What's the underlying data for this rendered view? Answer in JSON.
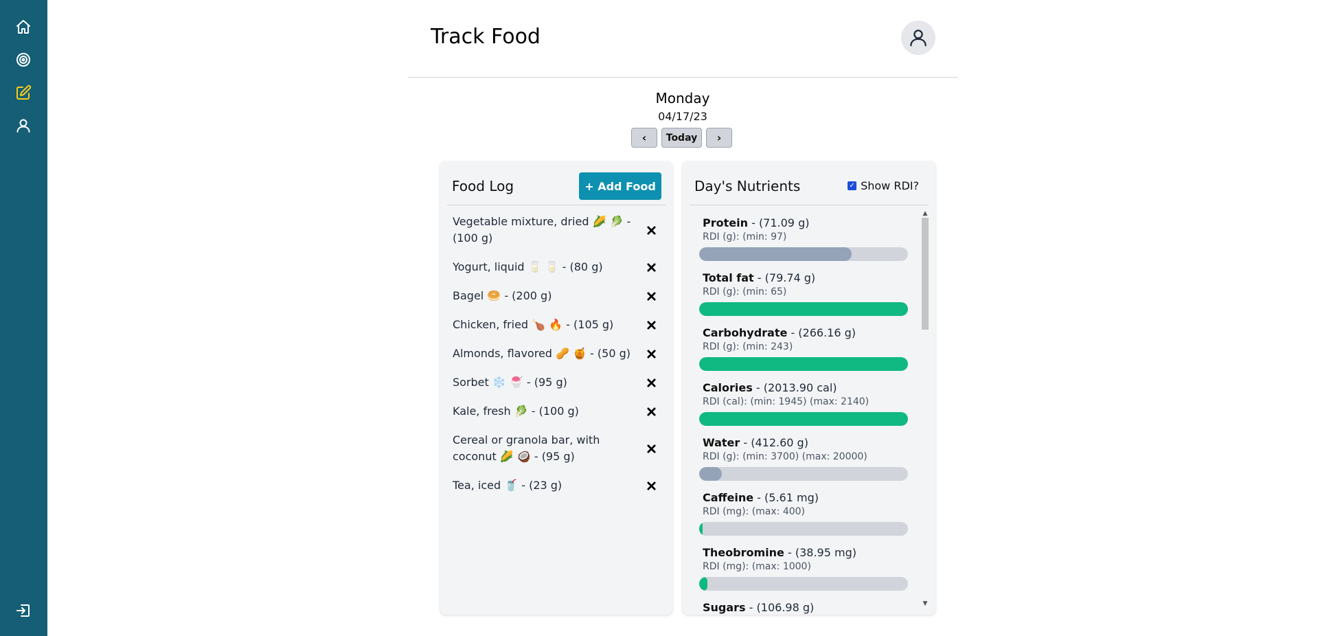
{
  "nav": {
    "items": [
      {
        "name": "home",
        "icon": "home-icon"
      },
      {
        "name": "goals",
        "icon": "target-icon"
      },
      {
        "name": "track",
        "icon": "edit-icon",
        "active": true
      },
      {
        "name": "profile",
        "icon": "user-icon"
      }
    ],
    "logout_icon": "logout-icon"
  },
  "header": {
    "title": "Track Food",
    "avatar_icon": "user-icon"
  },
  "date": {
    "day": "Monday",
    "date": "04/17/23",
    "prev_label": "‹",
    "today_label": "Today",
    "next_label": "›"
  },
  "food_log": {
    "title": "Food Log",
    "add_label": "+ Add Food",
    "items": [
      "Vegetable mixture, dried 🌽 🥬 - (100 g)",
      "Yogurt, liquid 🥛 🥛 - (80 g)",
      "Bagel 🥯 - (200 g)",
      "Chicken, fried 🍗 🔥 - (105 g)",
      "Almonds, flavored 🥜 🍯 - (50 g)",
      "Sorbet ❄️ 🍧 - (95 g)",
      "Kale, fresh 🥬 - (100 g)",
      "Cereal or granola bar, with coconut 🌽 🥥 - (95 g)",
      "Tea, iced 🥤 - (23 g)"
    ]
  },
  "nutrients": {
    "title": "Day's Nutrients",
    "rdi_label": "Show RDI?",
    "rdi_checked": true,
    "colors": {
      "good": "#10b981",
      "low": "#94a3b8",
      "track": "#d1d5db"
    },
    "items": [
      {
        "name": "Protein",
        "amount": "- (71.09 g)",
        "rdi": "RDI (g): (min: 97)",
        "fill": 0.73,
        "status": "low"
      },
      {
        "name": "Total fat",
        "amount": "- (79.74 g)",
        "rdi": "RDI (g): (min: 65)",
        "fill": 1.0,
        "status": "good"
      },
      {
        "name": "Carbohydrate",
        "amount": "- (266.16 g)",
        "rdi": "RDI (g): (min: 243)",
        "fill": 1.0,
        "status": "good"
      },
      {
        "name": "Calories",
        "amount": "- (2013.90 cal)",
        "rdi": "RDI (cal): (min: 1945) (max: 2140)",
        "fill": 1.0,
        "status": "good"
      },
      {
        "name": "Water",
        "amount": "- (412.60 g)",
        "rdi": "RDI (g): (min: 3700) (max: 20000)",
        "fill": 0.11,
        "status": "low"
      },
      {
        "name": "Caffeine",
        "amount": "- (5.61 mg)",
        "rdi": "RDI (mg): (max: 400)",
        "fill": 0.014,
        "status": "good"
      },
      {
        "name": "Theobromine",
        "amount": "- (38.95 mg)",
        "rdi": "RDI (mg): (max: 1000)",
        "fill": 0.039,
        "status": "good"
      },
      {
        "name": "Sugars",
        "amount": "- (106.98 g)",
        "rdi": "",
        "fill": 0,
        "status": "good"
      }
    ]
  }
}
